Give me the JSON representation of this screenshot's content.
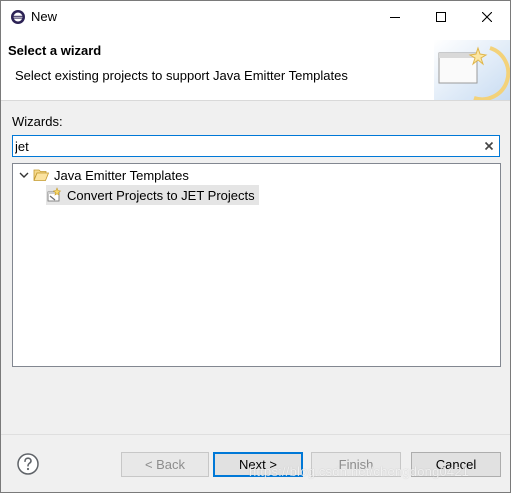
{
  "window": {
    "title": "New",
    "minimize_icon": "minimize-icon",
    "maximize_icon": "maximize-icon",
    "close_icon": "close-icon"
  },
  "header": {
    "title": "Select a wizard",
    "description": "Select existing projects to support Java Emitter Templates"
  },
  "wizards": {
    "label": "Wizards:",
    "filter_value": "jet",
    "tree": [
      {
        "label": "Java Emitter Templates",
        "expanded": true,
        "icon": "folder-open-icon",
        "children": [
          {
            "label": "Convert Projects to JET Projects",
            "icon": "wizard-icon",
            "selected": true
          }
        ]
      }
    ]
  },
  "buttons": {
    "back": "< Back",
    "next": "Next >",
    "finish": "Finish",
    "cancel": "Cancel"
  },
  "watermark": "https://blog.csdn.net/chengdong0421",
  "colors": {
    "accent": "#0078d7",
    "selection": "#e5e5e5",
    "folder": "#e8b94a"
  }
}
